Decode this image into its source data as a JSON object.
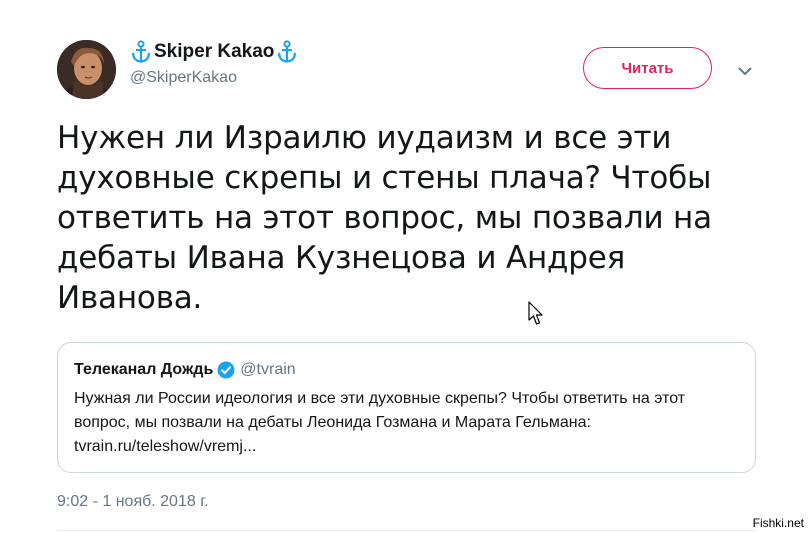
{
  "author": {
    "display_name": "Skiper Kakao",
    "handle": "@SkiperKakao",
    "name_icons": [
      "anchor-icon",
      "anchor-icon"
    ]
  },
  "follow_button": {
    "label": "Читать",
    "color": "#e0245e"
  },
  "tweet": {
    "text_lines": [
      "Нужен ли Израилю иудаизм и все эти",
      "духовные скрепы и стены плача? Чтобы",
      "ответить на этот вопрос, мы позвали на",
      "дебаты Ивана Кузнецова и Андрея",
      "Иванова."
    ]
  },
  "quote": {
    "name": "Телеканал Дождь",
    "handle": "@tvrain",
    "verified": true,
    "text_lines": [
      "Нужная ли России идеология и все эти духовные скрепы? Чтобы ответить на этот",
      "вопрос, мы позвали на дебаты Леонида Гозмана и Марата Гельмана:",
      "tvrain.ru/teleshow/vremj..."
    ]
  },
  "timestamp": "9:02 - 1 нояб. 2018 г.",
  "watermark": "Fishki.net",
  "colors": {
    "accent": "#e0245e",
    "verified": "#1da1f2",
    "secondary_text": "#657786",
    "anchor": "#1da1f2"
  }
}
